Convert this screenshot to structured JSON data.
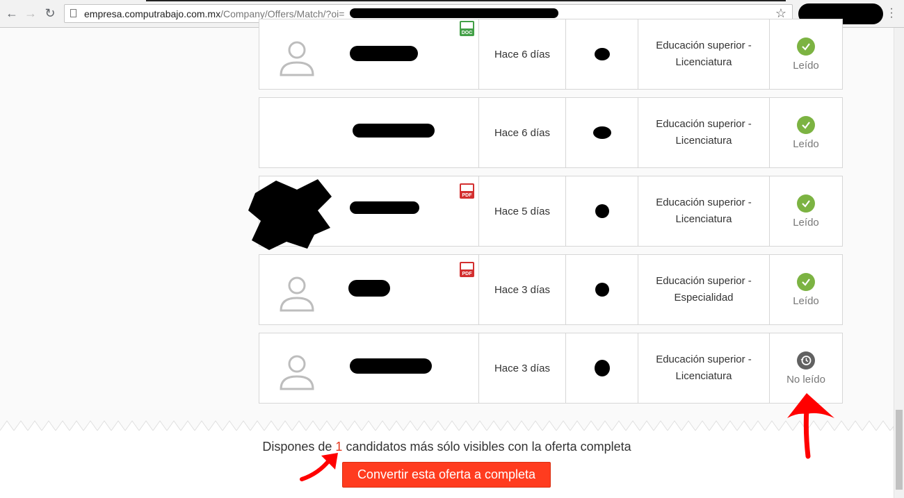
{
  "browser": {
    "url_host": "empresa.computrabajo.com.mx",
    "url_path": "/Company/Offers/Match/?oi="
  },
  "rows": [
    {
      "date": "Hace 6 días",
      "edu_line1": "Educación superior -",
      "edu_line2": "Licenciatura",
      "status": "Leído",
      "status_type": "read",
      "file_badge": "DOC",
      "avatar": true
    },
    {
      "date": "Hace 6 días",
      "edu_line1": "Educación superior -",
      "edu_line2": "Licenciatura",
      "status": "Leído",
      "status_type": "read",
      "file_badge": null,
      "avatar": false
    },
    {
      "date": "Hace 5 días",
      "edu_line1": "Educación superior -",
      "edu_line2": "Licenciatura",
      "status": "Leído",
      "status_type": "read",
      "file_badge": "PDF",
      "avatar": false
    },
    {
      "date": "Hace 3 días",
      "edu_line1": "Educación superior -",
      "edu_line2": "Especialidad",
      "status": "Leído",
      "status_type": "read",
      "file_badge": "PDF",
      "avatar": true
    },
    {
      "date": "Hace 3 días",
      "edu_line1": "Educación superior -",
      "edu_line2": "Licenciatura",
      "status": "No leído",
      "status_type": "unread",
      "file_badge": null,
      "avatar": true
    }
  ],
  "footer": {
    "text_before": "Dispones de ",
    "count": "1",
    "text_after": " candidatos más sólo visibles con la oferta completa",
    "button_label": "Convertir esta oferta a completa"
  },
  "colors": {
    "read_green": "#7cb342",
    "unread_gray": "#616161",
    "doc_green": "#43a047",
    "pdf_red": "#d32f2f",
    "cta": "#ff3c1f",
    "annotation_red": "#ff0000"
  }
}
